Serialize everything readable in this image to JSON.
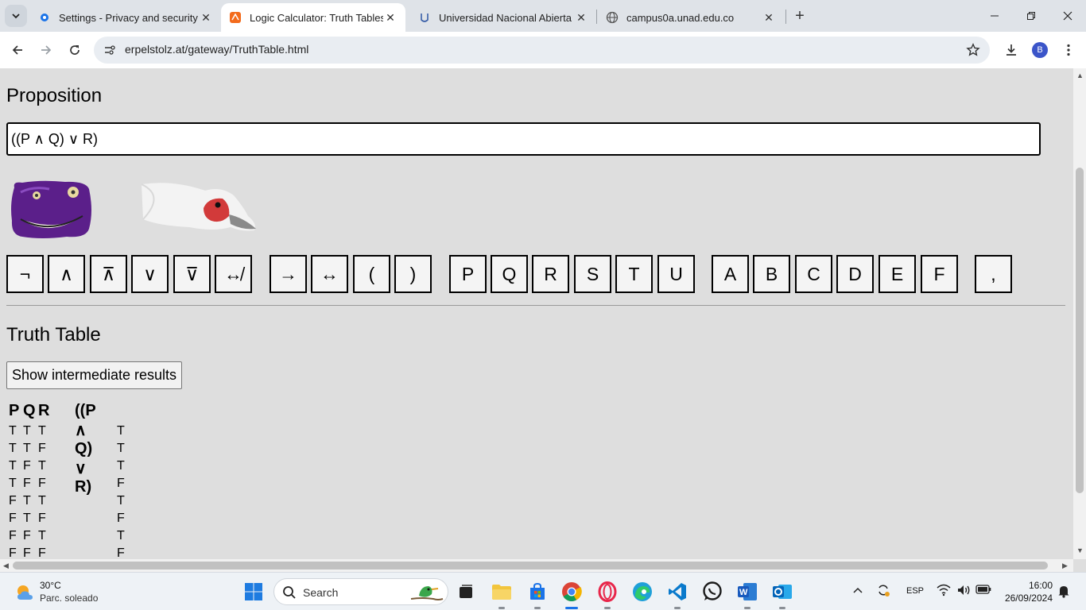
{
  "browser": {
    "tabs": [
      {
        "title": "Settings - Privacy and security",
        "icon": "gear-icon",
        "active": false
      },
      {
        "title": "Logic Calculator: Truth Tables (f",
        "icon": "logic-favicon",
        "active": true
      },
      {
        "title": "Universidad Nacional Abierta y",
        "icon": "unad-favicon",
        "active": false
      },
      {
        "title": "campus0a.unad.edu.co",
        "icon": "globe-icon",
        "active": false
      }
    ],
    "url": "erpelstolz.at/gateway/TruthTable.html",
    "profile_initial": "B"
  },
  "page": {
    "proposition_heading": "Proposition",
    "proposition_value": "((P ∧ Q) ∨ R)",
    "keys": [
      "¬",
      "∧",
      "⊼",
      "∨",
      "⊽",
      "↮",
      "→",
      "↔",
      "(",
      ")",
      "P",
      "Q",
      "R",
      "S",
      "T",
      "U",
      "A",
      "B",
      "C",
      "D",
      "E",
      "F",
      ","
    ],
    "truth_heading": "Truth Table",
    "show_button": "Show intermediate results",
    "table": {
      "headers": [
        "P",
        "Q",
        "R",
        "((P ∧ Q) ∨ R)"
      ],
      "rows": [
        [
          "T",
          "T",
          "T",
          "T"
        ],
        [
          "T",
          "T",
          "F",
          "T"
        ],
        [
          "T",
          "F",
          "T",
          "T"
        ],
        [
          "T",
          "F",
          "F",
          "F"
        ],
        [
          "F",
          "T",
          "T",
          "T"
        ],
        [
          "F",
          "T",
          "F",
          "F"
        ],
        [
          "F",
          "F",
          "T",
          "T"
        ],
        [
          "F",
          "F",
          "F",
          "F"
        ]
      ]
    }
  },
  "taskbar": {
    "weather_temp": "30°C",
    "weather_cond": "Parc. soleado",
    "search_label": "Search",
    "language": "ESP",
    "time": "16:00",
    "date": "26/09/2024"
  }
}
